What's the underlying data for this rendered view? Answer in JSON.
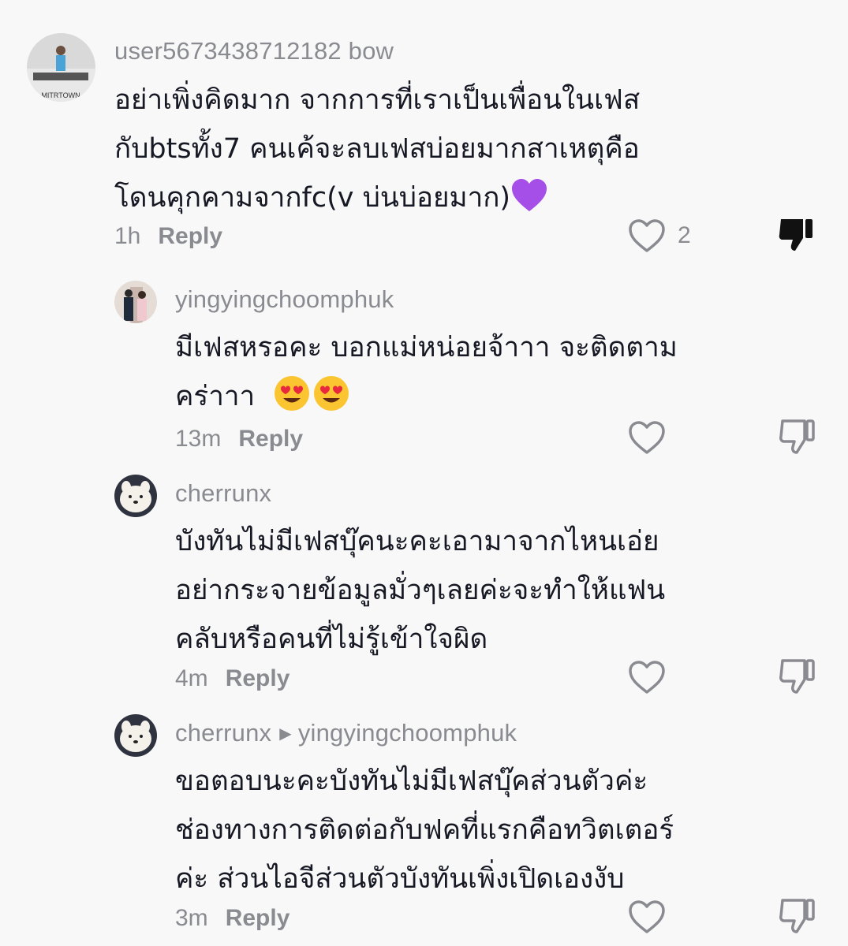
{
  "comments": [
    {
      "username": "user5673438712182 bow",
      "lines": [
        "อย่าเพิ่งคิดมาก จากการที่เราเป็นเพื่อนในเฟส",
        "กับbtsทั้ง7 คนเค้จะลบเฟสบ่อยมากสาเหตุคือ",
        "โดนคุกคามจากfc(v บ่นบ่อยมาก)"
      ],
      "time": "1h",
      "reply": "Reply",
      "likes": "2",
      "disliked": true,
      "avatar_text": "MITRTOWN"
    },
    {
      "username": "yingyingchoomphuk",
      "lines": [
        "มีเฟสหรอคะ บอกแม่หน่อยจ้าาา จะติดตาม",
        "คร่าาา"
      ],
      "time": "13m",
      "reply": "Reply"
    },
    {
      "username": "cherrunx",
      "lines": [
        "บังทันไม่มีเฟสบุ๊คนะคะเอามาจากไหนเอ่ย",
        "อย่ากระจายข้อมูลมั่วๆเลยค่ะจะทำให้แฟน",
        "คลับหรือคนที่ไม่รู้เข้าใจผิด"
      ],
      "time": "4m",
      "reply": "Reply"
    },
    {
      "username": "cherrunx",
      "reply_to": "yingyingchoomphuk",
      "lines": [
        "ขอตอบนะคะบังทันไม่มีเฟสบุ๊คส่วนตัวค่ะ",
        "ช่องทางการติดต่อกับฟคที่แรกคือทวิตเตอร์",
        "ค่ะ ส่วนไอจีส่วนตัวบังทันเพิ่งเปิดเองงับ"
      ],
      "time": "3m",
      "reply": "Reply"
    }
  ],
  "icons": {
    "like": "heart-outline-icon",
    "dislike": "thumbs-down-icon",
    "reply_arrow": "caret-right-icon",
    "emoji_heart_eyes": "heart-eyes-emoji",
    "emoji_purple_heart": "purple-heart-emoji"
  },
  "colors": {
    "background": "#f8f8f8",
    "text": "#161823",
    "secondary": "#8a8b91",
    "purple_heart": "#a64ee8"
  }
}
